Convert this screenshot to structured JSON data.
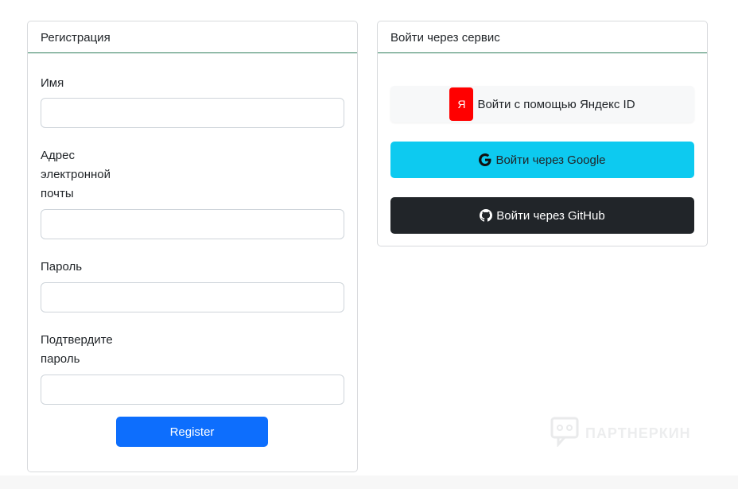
{
  "registration": {
    "header": "Регистрация",
    "name_label": "Имя",
    "email_label": "Адрес электронной почты",
    "password_label": "Пароль",
    "confirm_label": "Подтвердите пароль",
    "name_value": "",
    "email_value": "",
    "password_value": "",
    "confirm_value": "",
    "register_button": "Register"
  },
  "services": {
    "header": "Войти через сервис",
    "yandex_icon_text": "Я",
    "yandex_label": "Войти с помощью Яндекс ID",
    "google_label": "Войти через Google",
    "github_label": "Войти через GitHub"
  },
  "watermark": {
    "text": "ПАРТНЕРКИН"
  },
  "colors": {
    "primary": "#0d6efd",
    "google_bg": "#0dcaf0",
    "github_bg": "#212529",
    "yandex_red": "#ff0000",
    "header_border": "#2f7d5b"
  }
}
